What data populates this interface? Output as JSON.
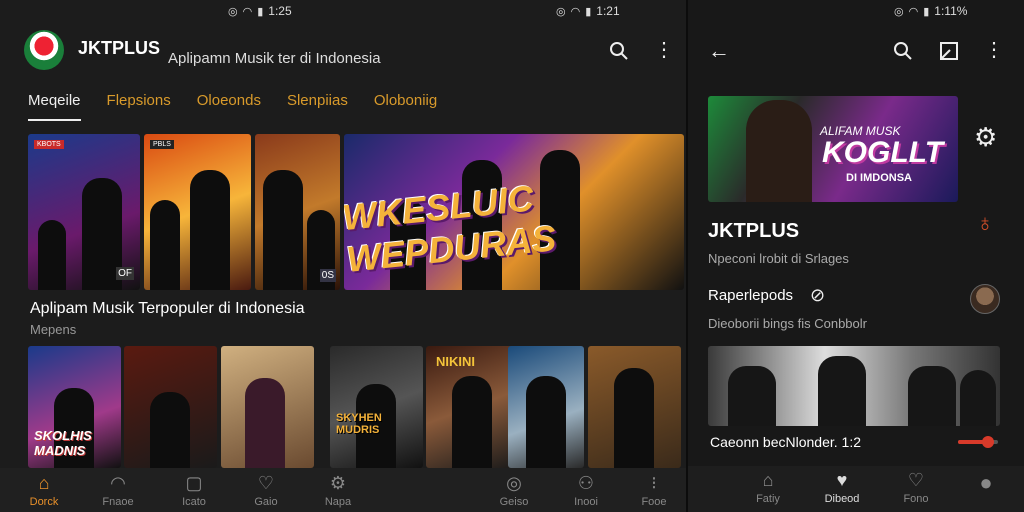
{
  "left": {
    "status_time": "1:25",
    "status_time_b": "1:21",
    "brand": "JKTPLUS",
    "tagline": "Aplipamn Musik ter di Indonesia",
    "tabs": [
      {
        "label": "Meqeile",
        "active": true
      },
      {
        "label": "Flepsions",
        "active": false
      },
      {
        "label": "Oloeonds",
        "active": false
      },
      {
        "label": "Slenpiias",
        "active": false
      },
      {
        "label": "Oloboniig",
        "active": false
      }
    ],
    "banner_badges": [
      "KBOTS",
      "PBLS",
      "",
      ""
    ],
    "banner_corner_labels": [
      "OF",
      "0S"
    ],
    "featured_title": "WKESLUIC WEPDURAS",
    "section_title": "Aplipam Musik Terpopuler di Indonesia",
    "section_sub": "Mepens",
    "row2_texts": [
      "SKOLHIS MADNIS",
      "NIKINI",
      "SKYHEN MUDRIS"
    ],
    "nav": [
      {
        "label": "Dorck",
        "icon": "home-icon",
        "active": true
      },
      {
        "label": "Fnaoe",
        "icon": "discover-icon",
        "active": false
      },
      {
        "label": "Icato",
        "icon": "library-icon",
        "active": false
      },
      {
        "label": "Gaio",
        "icon": "heart-icon",
        "active": false
      },
      {
        "label": "Napa",
        "icon": "settings-icon",
        "active": false
      },
      {
        "label": "Geiso",
        "icon": "radio-icon",
        "active": false
      },
      {
        "label": "Inooi",
        "icon": "profile-icon",
        "active": false
      },
      {
        "label": "Fooe",
        "icon": "more-icon",
        "active": false
      }
    ]
  },
  "right": {
    "status_time": "1:11%",
    "hero_line1": "ALIFAM MUSK",
    "hero_line2": "KOGLLT",
    "hero_line3": "DI IMDONSA",
    "title": "JKTPLUS",
    "subtitle": "Npeconi lrobit di Srlages",
    "row1": "Raperlepods",
    "row2": "Dieoborii bings fis Conbbolr",
    "caption": "Caeonn becNlonder. 1:2",
    "progress": 0.75,
    "nav": [
      {
        "label": "Fatiy",
        "icon": "home-icon"
      },
      {
        "label": "Dibeod",
        "icon": "heart-icon"
      },
      {
        "label": "Fono",
        "icon": "favorites-icon"
      },
      {
        "label": "",
        "icon": "profile-icon"
      }
    ]
  },
  "colors": {
    "accent": "#e8902a",
    "bg": "#1c1c1c",
    "red": "#d83a2a"
  }
}
